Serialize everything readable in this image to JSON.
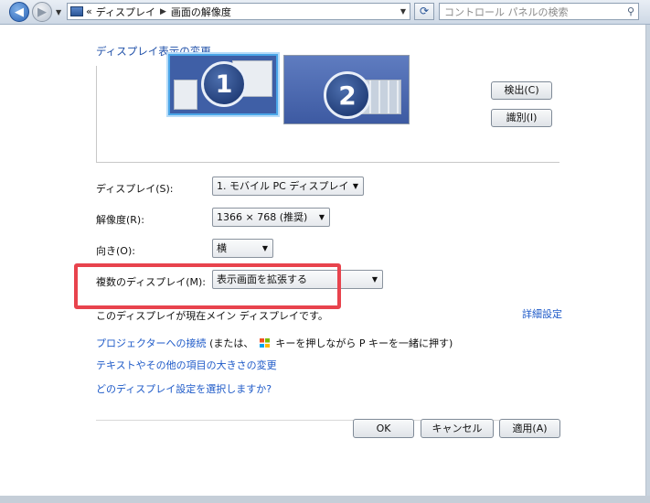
{
  "address": {
    "chevron": "«",
    "crumb1": "ディスプレイ",
    "crumb2": "画面の解像度",
    "search_placeholder": "コントロール パネルの検索"
  },
  "panel": {
    "heading": "ディスプレイ表示の変更",
    "monitor1_number": "1",
    "monitor2_number": "2",
    "detect_button": "検出(C)",
    "identify_button": "識別(I)"
  },
  "settings": {
    "display_label": "ディスプレイ(S):",
    "display_value": "1. モバイル PC ディスプレイ",
    "resolution_label": "解像度(R):",
    "resolution_value": "1366 × 768 (推奨)",
    "orientation_label": "向き(O):",
    "orientation_value": "横",
    "multi_label": "複数のディスプレイ(M):",
    "multi_value": "表示画面を拡張する"
  },
  "message": "このディスプレイが現在メイン ディスプレイです。",
  "advanced_link": "詳細設定",
  "links": {
    "projector_link": "プロジェクターへの接続",
    "projector_hint_pre": "(または、",
    "projector_hint_post": "キーを押しながら P キーを一緒に押す)",
    "text_size_link": "テキストやその他の項目の大きさの変更",
    "which_setting_link": "どのディスプレイ設定を選択しますか?"
  },
  "footer": {
    "ok_button": "OK",
    "cancel_button": "キャンセル",
    "apply_button": "適用(A)"
  },
  "colors": {
    "highlight": "#e8434d",
    "link": "#1e5ac8"
  }
}
